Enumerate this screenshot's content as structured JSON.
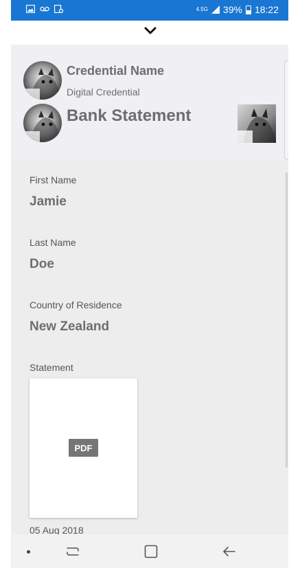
{
  "status_bar": {
    "network_type": "4.5G",
    "battery_percent": "39%",
    "time": "18:22",
    "left_icons": [
      "gallery-icon",
      "voicemail-icon",
      "screenshot-icon"
    ],
    "background_color": "#1976d2"
  },
  "collapse": {
    "icon": "chevron-down-icon"
  },
  "header": {
    "credential_name": "Credential Name",
    "credential_type": "Digital Credential",
    "document_title": "Bank Statement",
    "avatar_image": "kitten-photo",
    "thumbnail_image": "kitten-photo"
  },
  "fields": [
    {
      "label": "First Name",
      "value": "Jamie"
    },
    {
      "label": "Last Name",
      "value": "Doe"
    },
    {
      "label": "Country of Residence",
      "value": "New Zealand"
    }
  ],
  "attachment": {
    "label": "Statement",
    "badge": "PDF",
    "date": "05 Aug 2018"
  },
  "nav_bar": {
    "buttons": [
      "dot-indicator",
      "recent-apps-icon",
      "home-icon",
      "back-icon"
    ]
  }
}
